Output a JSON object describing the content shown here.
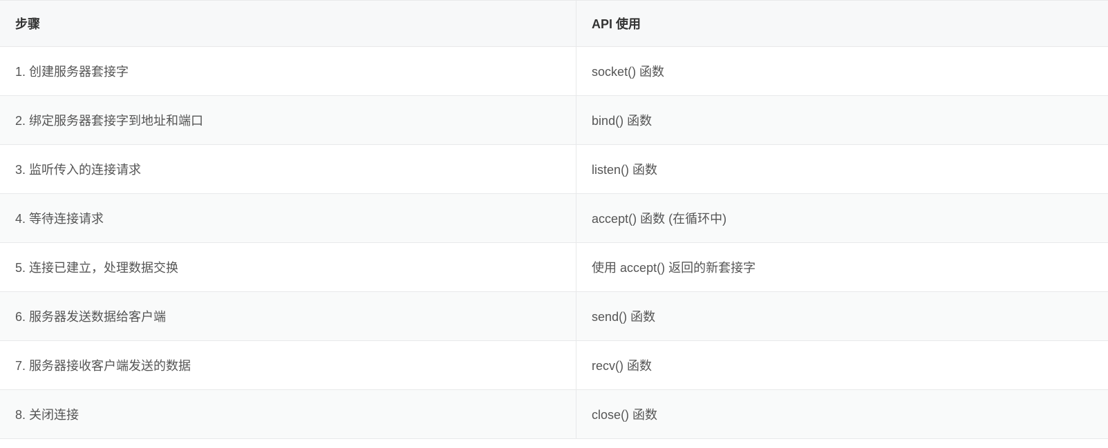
{
  "table": {
    "headers": {
      "step": "步骤",
      "api": "API 使用"
    },
    "rows": [
      {
        "step": "1. 创建服务器套接字",
        "api": "socket() 函数"
      },
      {
        "step": "2. 绑定服务器套接字到地址和端口",
        "api": "bind() 函数"
      },
      {
        "step": "3. 监听传入的连接请求",
        "api": "listen() 函数"
      },
      {
        "step": "4. 等待连接请求",
        "api": "accept() 函数 (在循环中)"
      },
      {
        "step": "5. 连接已建立，处理数据交换",
        "api": "使用 accept() 返回的新套接字"
      },
      {
        "step": "6. 服务器发送数据给客户端",
        "api": "send() 函数"
      },
      {
        "step": "7. 服务器接收客户端发送的数据",
        "api": "recv() 函数"
      },
      {
        "step": "8. 关闭连接",
        "api": "close() 函数"
      }
    ]
  }
}
